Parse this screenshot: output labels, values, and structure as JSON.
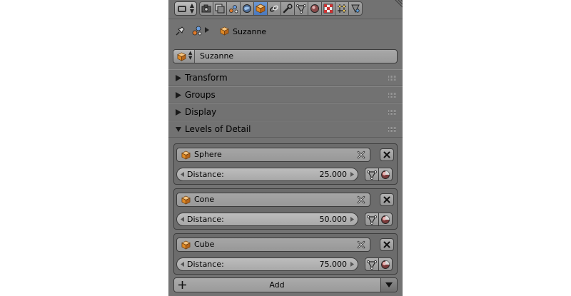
{
  "context": {
    "object_label": "Suzanne"
  },
  "object_name": {
    "value": "Suzanne"
  },
  "panels": [
    {
      "label": "Transform",
      "expanded": false
    },
    {
      "label": "Groups",
      "expanded": false
    },
    {
      "label": "Display",
      "expanded": false
    },
    {
      "label": "Levels of Detail",
      "expanded": true
    }
  ],
  "lod_levels": [
    {
      "object": "Sphere",
      "distance_label": "Distance:",
      "distance_value": "25.000"
    },
    {
      "object": "Cone",
      "distance_label": "Distance:",
      "distance_value": "50.000"
    },
    {
      "object": "Cube",
      "distance_label": "Distance:",
      "distance_value": "75.000"
    }
  ],
  "add_button": {
    "label": "Add"
  },
  "colors": {
    "active_tab": "#5a86c8",
    "panel_bg": "#737373",
    "cube_orange": "#e8902a"
  }
}
